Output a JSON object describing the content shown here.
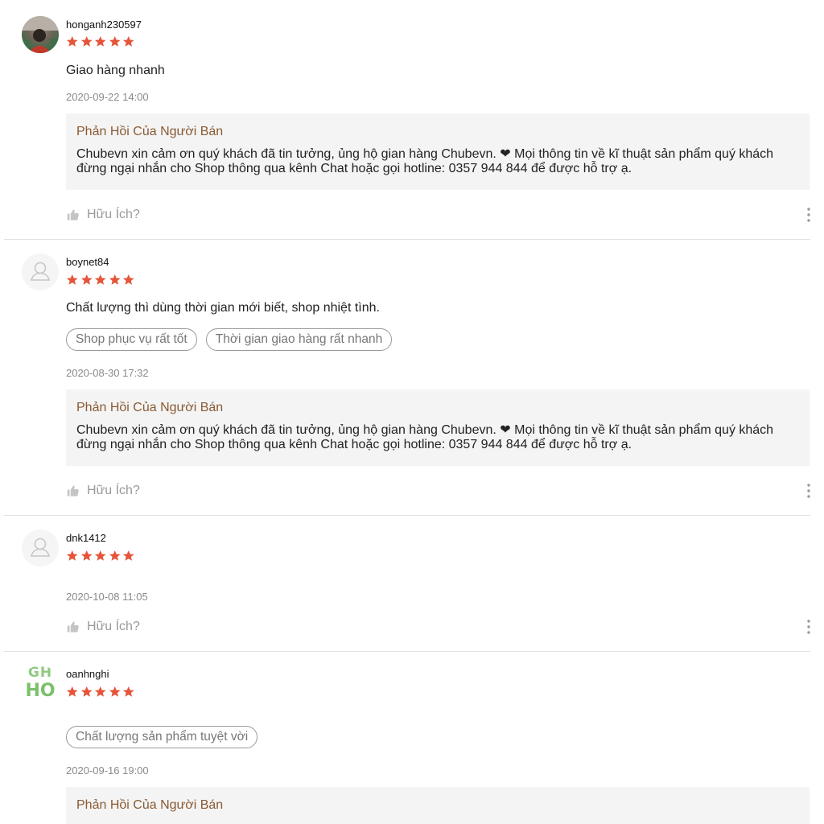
{
  "colors": {
    "star": "#e5553b",
    "reply_title": "#8a5a33",
    "logo_green": "#7cc06b"
  },
  "reviews": [
    {
      "username": "honganh230597",
      "avatar": "photo-avatar",
      "rating": 5,
      "comment": "Giao hàng nhanh",
      "time": "2020-09-22 14:00",
      "reply_title": "Phản Hồi Của Người Bán",
      "reply_body": "Chubevn xin cảm ơn quý khách đã tin tưởng, ủng hộ gian hàng Chubevn. ❤ Mọi thông tin về kĩ thuật sản phẩm quý khách đừng ngại nhắn cho Shop thông qua kênh Chat hoặc gọi hotline: 0357 944 844 để được hỗ trợ ạ.",
      "helpful": "Hữu Ích?"
    },
    {
      "username": "boynet84",
      "avatar": "default-user-icon",
      "rating": 5,
      "comment": "Chất lượng thì dùng thời gian mới biết,  shop nhiệt tình.",
      "tags": [
        "Shop phục vụ rất tốt",
        "Thời gian giao hàng rất nhanh"
      ],
      "time": "2020-08-30 17:32",
      "reply_title": "Phản Hồi Của Người Bán",
      "reply_body": "Chubevn xin cảm ơn quý khách đã tin tưởng, ủng hộ gian hàng Chubevn. ❤ Mọi thông tin về kĩ thuật sản phẩm quý khách đừng ngại nhắn cho Shop thông qua kênh Chat hoặc gọi hotline: 0357 944 844 để được hỗ trợ ạ.",
      "helpful": "Hữu Ích?"
    },
    {
      "username": "dnk1412",
      "avatar": "default-user-icon",
      "rating": 5,
      "time": "2020-10-08 11:05",
      "helpful": "Hữu Ích?"
    },
    {
      "username": "oanhnghi",
      "avatar": "logo-avatar",
      "avatar_text": [
        "GH",
        "HO"
      ],
      "rating": 5,
      "tags": [
        "Chất lượng sản phẩm tuyệt vời"
      ],
      "time": "2020-09-16 19:00",
      "reply_title": "Phản Hồi Của Người Bán"
    }
  ]
}
